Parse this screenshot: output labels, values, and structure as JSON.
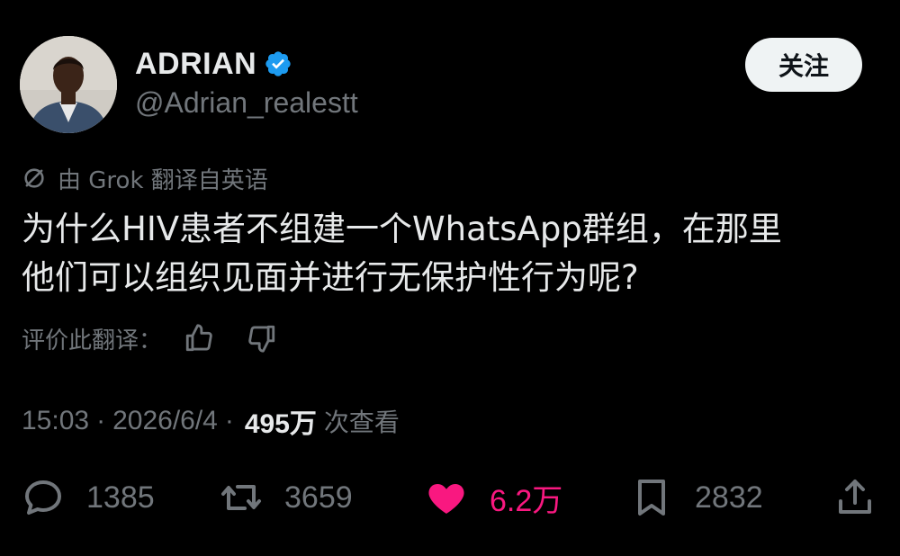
{
  "author": {
    "display_name": "ADRIAN",
    "handle": "@Adrian_realestt",
    "verified_icon": "verified-badge-icon"
  },
  "follow_label": "关注",
  "translation": {
    "note": "由 Grok 翻译自英语",
    "rate_label": "评价此翻译："
  },
  "tweet": {
    "lines": [
      "为什么HIV患者不组建一个WhatsApp群组，在那里",
      "他们可以组织见面并进行无保护性行为呢?"
    ]
  },
  "meta": {
    "time": "15:03",
    "separator": "·",
    "date": "2026/6/4",
    "views_count": "495万",
    "views_label": "次查看"
  },
  "actions": {
    "replies": "1385",
    "retweets": "3659",
    "likes": "6.2万",
    "bookmarks": "2832"
  },
  "colors": {
    "background": "#000000",
    "primary_text": "#e7e9ea",
    "secondary_text": "#71767b",
    "verified_blue": "#1d9bf0",
    "like_pink": "#f91880",
    "follow_bg": "#eff3f4"
  }
}
